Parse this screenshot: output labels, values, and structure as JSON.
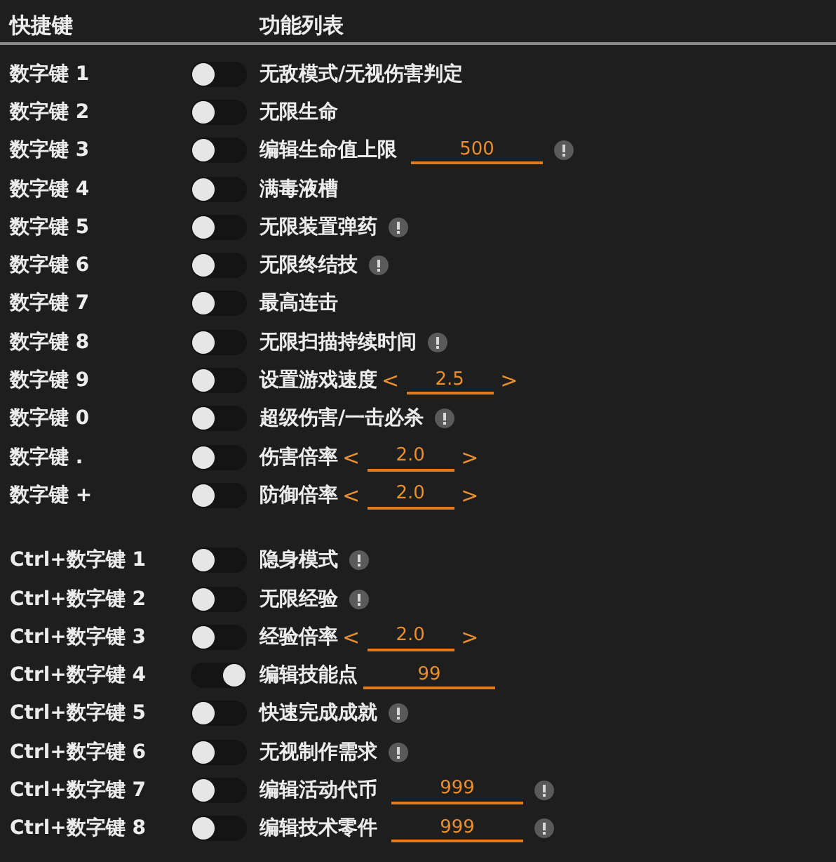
{
  "header": {
    "hotkey_column": "快捷键",
    "function_column": "功能列表"
  },
  "groups": [
    {
      "rows": [
        {
          "hotkey": "数字键 1",
          "on": false,
          "label": "无敌模式/无视伤害判定",
          "kind": "plain",
          "info": false
        },
        {
          "hotkey": "数字键 2",
          "on": false,
          "label": "无限生命",
          "kind": "plain",
          "info": false
        },
        {
          "hotkey": "数字键 3",
          "on": false,
          "label": "编辑生命值上限",
          "kind": "input",
          "value": "500",
          "info": true
        },
        {
          "hotkey": "数字键 4",
          "on": false,
          "label": "满毒液槽",
          "kind": "plain",
          "info": false
        },
        {
          "hotkey": "数字键 5",
          "on": false,
          "label": "无限装置弹药",
          "kind": "plain",
          "info": true
        },
        {
          "hotkey": "数字键 6",
          "on": false,
          "label": "无限终结技",
          "kind": "plain",
          "info": true
        },
        {
          "hotkey": "数字键 7",
          "on": false,
          "label": "最高连击",
          "kind": "plain",
          "info": false
        },
        {
          "hotkey": "数字键 8",
          "on": false,
          "label": "无限扫描持续时间",
          "kind": "plain",
          "info": true
        },
        {
          "hotkey": "数字键 9",
          "on": false,
          "label": "设置游戏速度",
          "kind": "stepper",
          "value": "2.5",
          "dec": "<",
          "inc": ">",
          "info": false
        },
        {
          "hotkey": "数字键 0",
          "on": false,
          "label": "超级伤害/一击必杀",
          "kind": "plain",
          "info": true
        },
        {
          "hotkey": "数字键 .",
          "on": false,
          "label": "伤害倍率",
          "kind": "stepper",
          "value": "2.0",
          "dec": "<",
          "inc": ">",
          "info": false
        },
        {
          "hotkey": "数字键 +",
          "on": false,
          "label": "防御倍率",
          "kind": "stepper",
          "value": "2.0",
          "dec": "<",
          "inc": ">",
          "info": false
        }
      ]
    },
    {
      "rows": [
        {
          "hotkey": "Ctrl+数字键 1",
          "on": false,
          "label": "隐身模式",
          "kind": "plain",
          "info": true
        },
        {
          "hotkey": "Ctrl+数字键 2",
          "on": false,
          "label": "无限经验",
          "kind": "plain",
          "info": true
        },
        {
          "hotkey": "Ctrl+数字键 3",
          "on": false,
          "label": "经验倍率",
          "kind": "stepper",
          "value": "2.0",
          "dec": "<",
          "inc": ">",
          "info": false
        },
        {
          "hotkey": "Ctrl+数字键 4",
          "on": true,
          "label": "编辑技能点",
          "kind": "input",
          "value": "99",
          "info": false
        },
        {
          "hotkey": "Ctrl+数字键 5",
          "on": false,
          "label": "快速完成成就",
          "kind": "plain",
          "info": true
        },
        {
          "hotkey": "Ctrl+数字键 6",
          "on": false,
          "label": "无视制作需求",
          "kind": "plain",
          "info": true
        },
        {
          "hotkey": "Ctrl+数字键 7",
          "on": false,
          "label": "编辑活动代币",
          "kind": "input",
          "value": "999",
          "info": true
        },
        {
          "hotkey": "Ctrl+数字键 8",
          "on": false,
          "label": "编辑技术零件",
          "kind": "input",
          "value": "999",
          "info": true
        }
      ]
    }
  ]
}
